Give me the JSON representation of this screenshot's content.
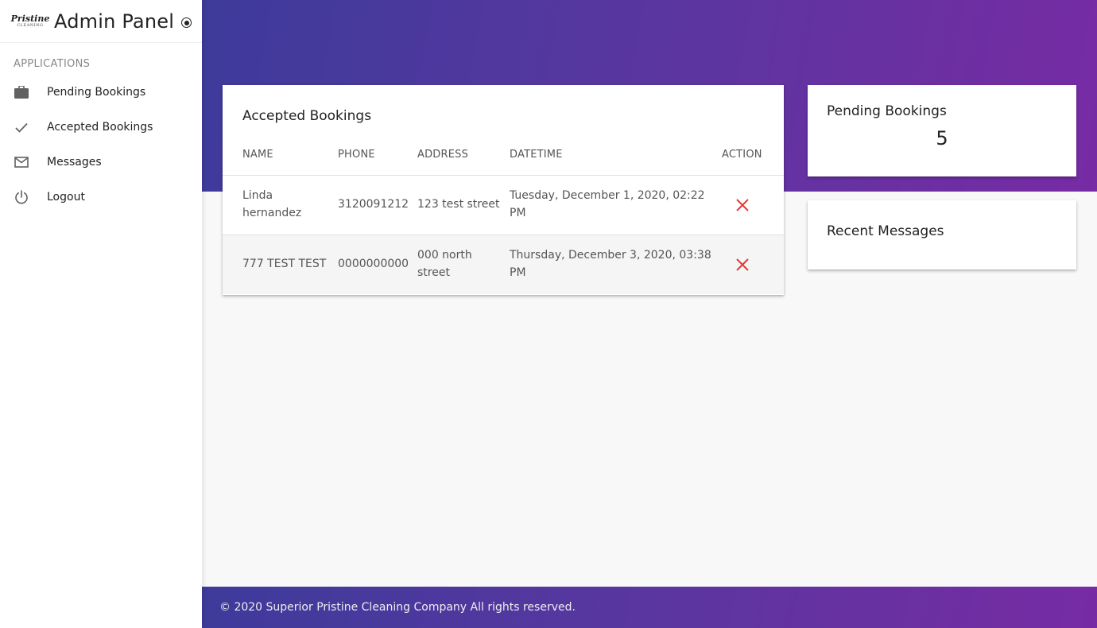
{
  "brand": {
    "logo_top": "Pristine",
    "logo_bottom": "CLEANING",
    "title": "Admin Panel"
  },
  "sidebar": {
    "section_label": "APPLICATIONS",
    "items": [
      {
        "label": "Pending Bookings",
        "icon": "briefcase-icon"
      },
      {
        "label": "Accepted Bookings",
        "icon": "check-icon"
      },
      {
        "label": "Messages",
        "icon": "mail-icon"
      },
      {
        "label": "Logout",
        "icon": "power-icon"
      }
    ]
  },
  "accepted": {
    "title": "Accepted Bookings",
    "columns": [
      "NAME",
      "PHONE",
      "ADDRESS",
      "DATETIME",
      "ACTION"
    ],
    "rows": [
      {
        "name": "Linda hernandez",
        "phone": "3120091212",
        "address": "123 test street",
        "datetime": "Tuesday, December 1, 2020, 02:22 PM"
      },
      {
        "name": "777 TEST TEST",
        "phone": "0000000000",
        "address": "000 north street",
        "datetime": "Thursday, December 3, 2020, 03:38 PM"
      }
    ]
  },
  "pending": {
    "title": "Pending Bookings",
    "count": "5"
  },
  "messages": {
    "title": "Recent Messages"
  },
  "footer": {
    "text": "© 2020 Superior Pristine Cleaning Company All rights reserved."
  },
  "colors": {
    "gradient_start": "#3d3b9b",
    "gradient_end": "#772ba4",
    "delete": "#e53935"
  }
}
